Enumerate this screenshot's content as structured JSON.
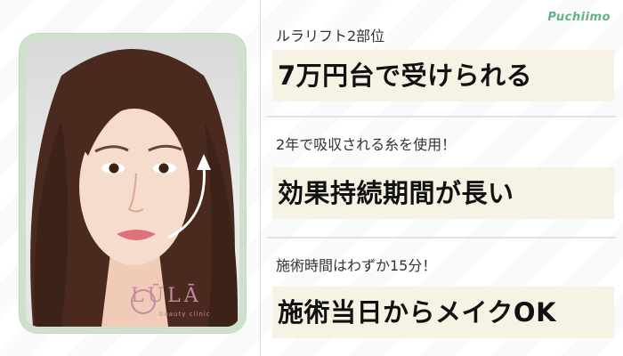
{
  "brand": {
    "logo_text": "Puchiimo"
  },
  "photo": {
    "clinic_logo": "LŪLĀ",
    "clinic_tagline": "beauty clinic",
    "arrow_icon": "curved-up-arrow"
  },
  "features": [
    {
      "subtitle": "ルラリフト2部位",
      "headline": "7万円台で受けられる"
    },
    {
      "subtitle": "2年で吸収される糸を使用！",
      "headline": "効果持続期間が長い"
    },
    {
      "subtitle": "施術時間はわずか15分！",
      "headline": "施術当日からメイクOK"
    }
  ],
  "colors": {
    "frame": "#cfe0cc",
    "highlight": "#f6f2e4",
    "brand": "#5fb38a"
  }
}
